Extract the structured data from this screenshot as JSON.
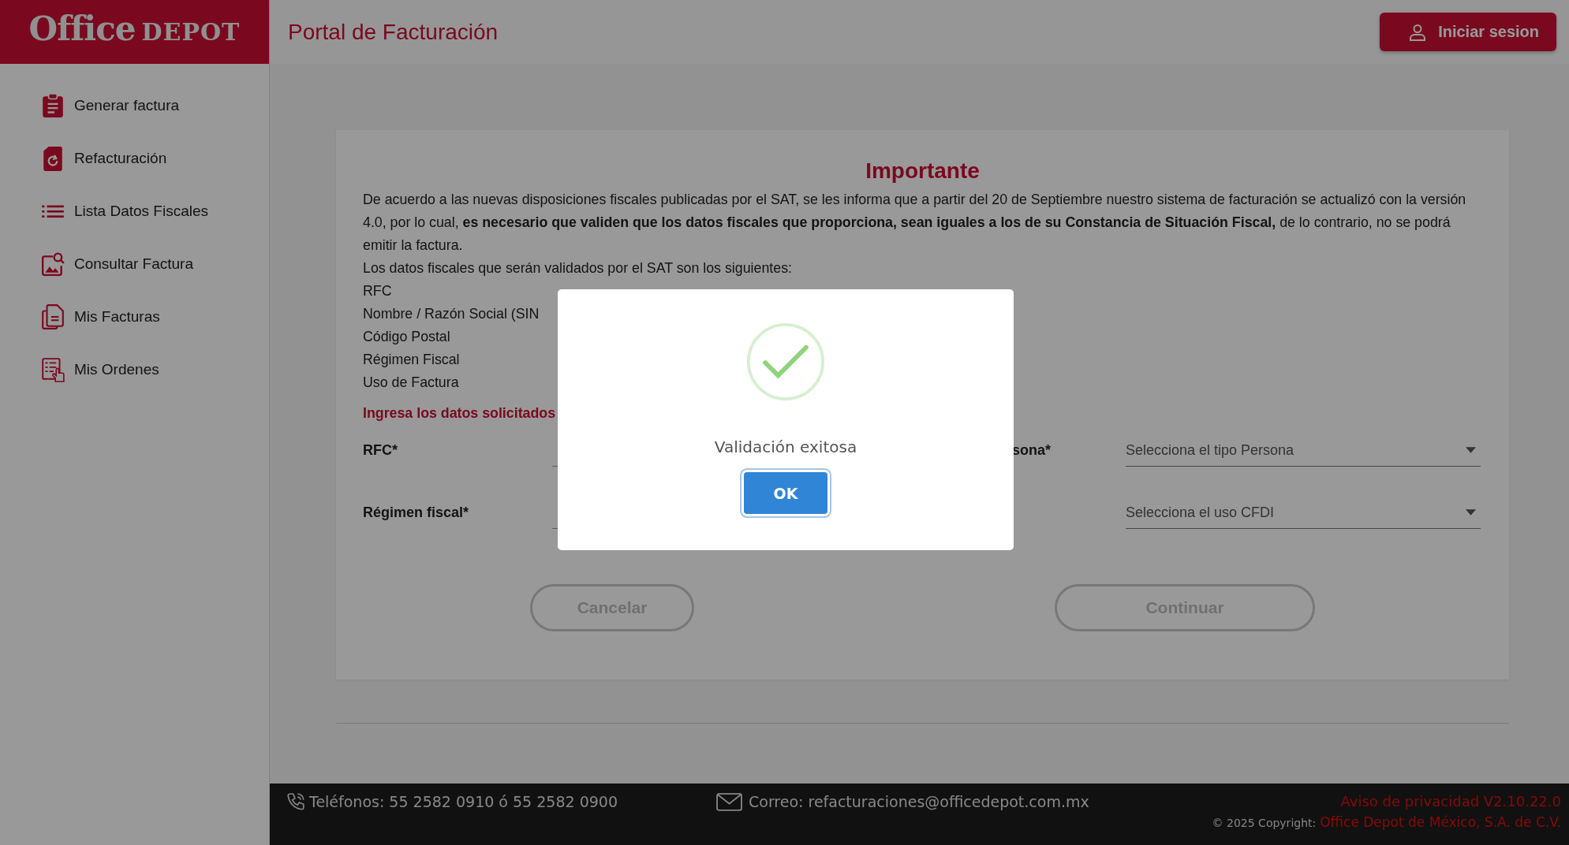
{
  "brand": {
    "logo_word_1": "Office",
    "logo_word_2": "DEPOT"
  },
  "header": {
    "title": "Portal de Facturación",
    "login_button": "Iniciar sesion"
  },
  "sidebar": {
    "items": [
      {
        "label": "Generar factura",
        "kind": "clipboard"
      },
      {
        "label": "Refacturación",
        "kind": "refresh"
      },
      {
        "label": "Lista Datos Fiscales",
        "kind": "list"
      },
      {
        "label": "Consultar Factura",
        "kind": "search-image"
      },
      {
        "label": "Mis Facturas",
        "kind": "documents"
      },
      {
        "label": "Mis Ordenes",
        "kind": "orders"
      }
    ]
  },
  "notice": {
    "title": "Importante",
    "paragraph": "De acuerdo a las nuevas disposiciones fiscales publicadas por el SAT, se les informa que a partir del 20 de Septiembre nuestro sistema de facturación se actualizó con la versión 4.0, por lo cual, **es necesario que validen que los datos fiscales que proporciona, sean iguales a los de su Constancia de Situación Fiscal,** de lo contrario, no se podrá emitir la factura.",
    "intro": "Los datos fiscales que serán validados por el SAT son los siguientes:",
    "fields": [
      "RFC",
      "Nombre / Razón Social (SIN",
      "Código Postal",
      "Régimen Fiscal",
      "Uso de Factura"
    ],
    "prompt": "Ingresa los datos solicitados"
  },
  "form": {
    "rows": [
      {
        "label": "RFC*",
        "label_2": "sona*",
        "select_placeholder": "Selecciona el tipo Persona"
      },
      {
        "label": "Régimen fiscal*",
        "select_placeholder": "Selecciona el uso CFDI"
      }
    ]
  },
  "buttons": [
    {
      "label": "Cancelar",
      "disabled": true
    },
    {
      "label": "Continuar",
      "disabled": true
    }
  ],
  "footer": {
    "phone": "Teléfonos: 55 2582 0910 ó 55 2582 0900",
    "email": "Correo: refacturaciones@officedepot.com.mx",
    "privacy": "Aviso de privacidad V2.10.22.0",
    "copyright": "© 2025 Copyright:",
    "company": "Office Depot de México, S.A. de C.V."
  },
  "modal": {
    "message": "Validación exitosa",
    "button": "OK"
  }
}
